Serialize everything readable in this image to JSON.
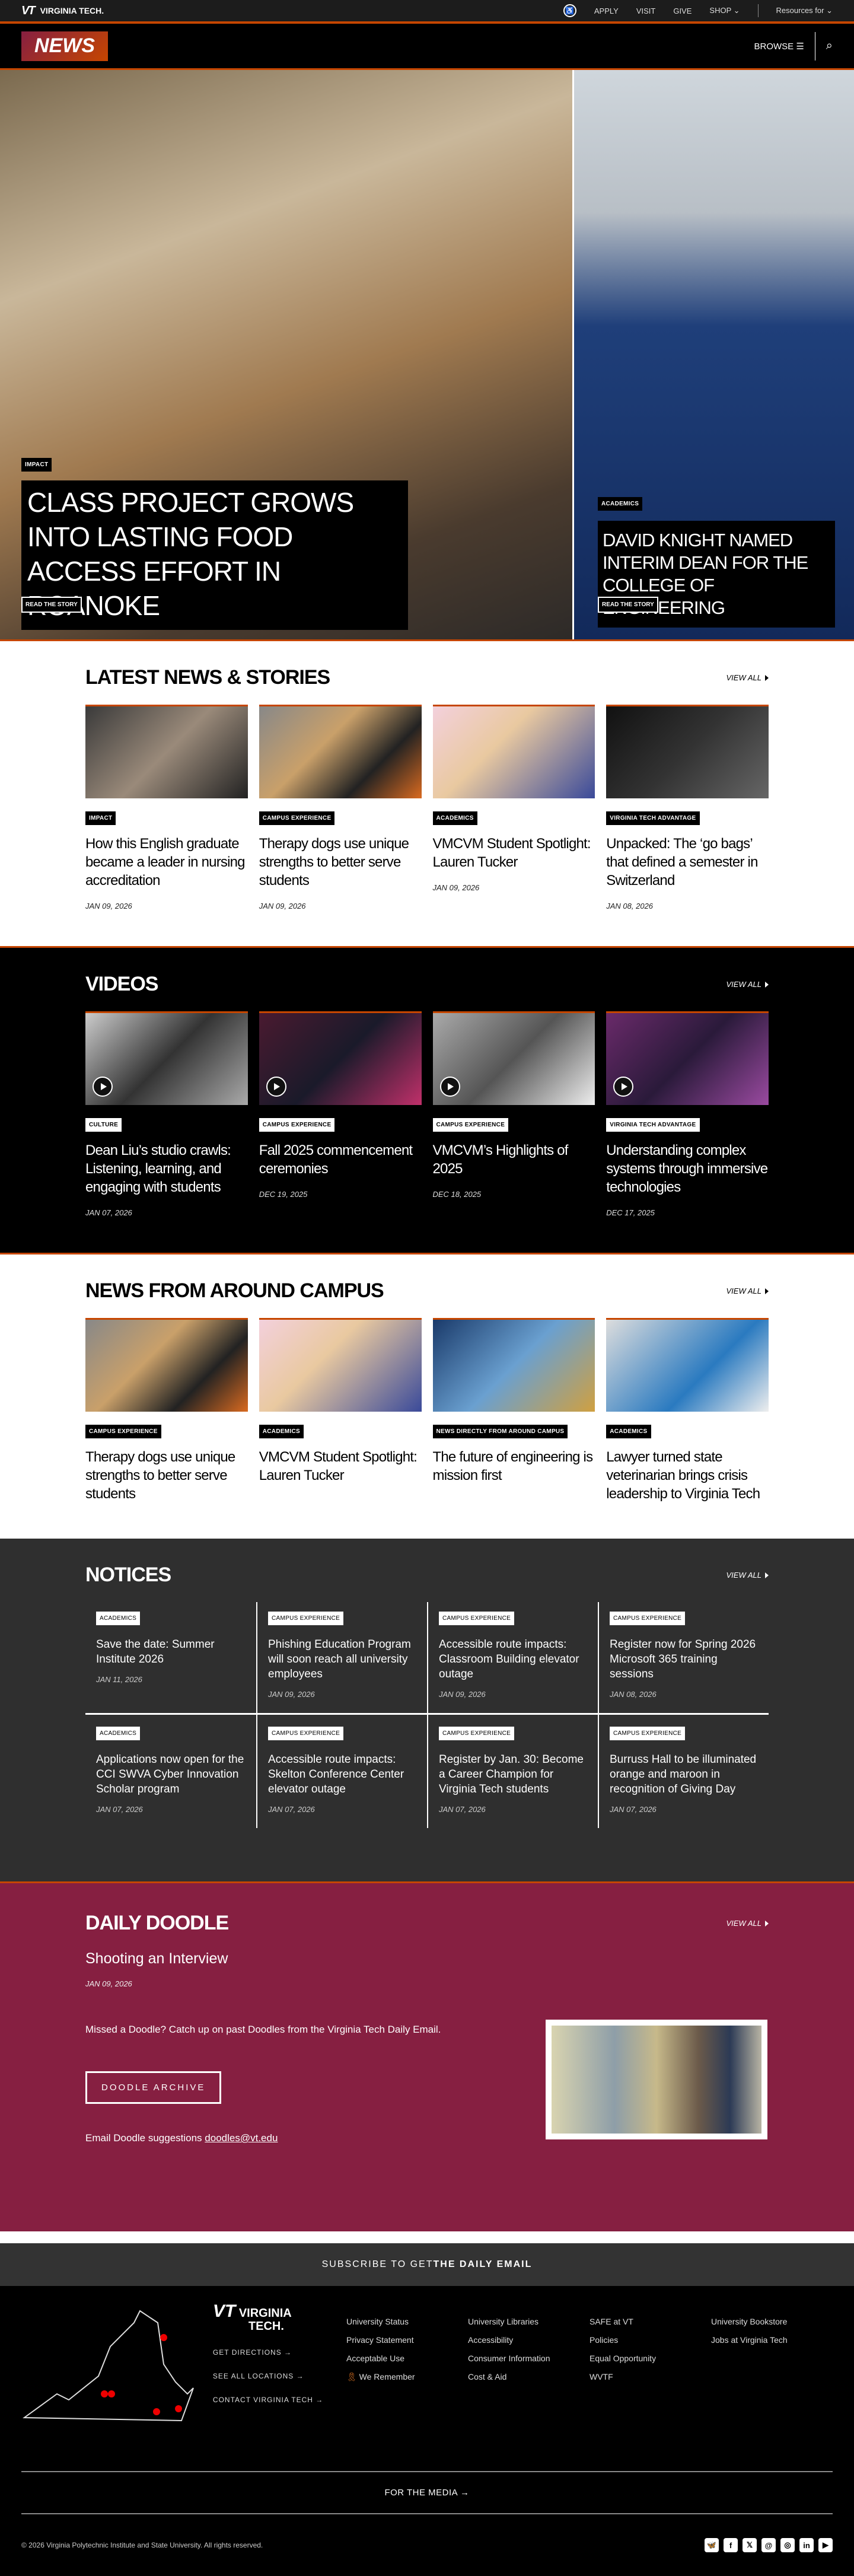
{
  "topbar": {
    "brand": "VIRGINIA TECH.",
    "links": [
      "APPLY",
      "VISIT",
      "GIVE",
      "SHOP",
      "Resources for"
    ]
  },
  "nav": {
    "logo": "NEWS",
    "browse": "BROWSE"
  },
  "hero": {
    "main": {
      "tag": "IMPACT",
      "title": "CLASS PROJECT GROWS INTO LASTING FOOD ACCESS EFFORT IN ROANOKE",
      "button": "READ THE STORY"
    },
    "side": {
      "tag": "ACADEMICS",
      "title": "DAVID KNIGHT NAMED INTERIM DEAN FOR THE COLLEGE OF ENGINEERING",
      "button": "READ THE STORY"
    }
  },
  "latest": {
    "title": "LATEST NEWS & STORIES",
    "view_all": "VIEW ALL",
    "items": [
      {
        "tag": "IMPACT",
        "title": "How this English graduate became a leader in nursing accreditation",
        "date": "JAN 09, 2026"
      },
      {
        "tag": "CAMPUS EXPERIENCE",
        "title": "Therapy dogs use unique strengths to better serve students",
        "date": "JAN 09, 2026"
      },
      {
        "tag": "ACADEMICS",
        "title": "VMCVM Student Spotlight: Lauren Tucker",
        "date": "JAN 09, 2026"
      },
      {
        "tag": "VIRGINIA TECH ADVANTAGE",
        "title": "Unpacked: The ‘go bags’ that defined a semester in Switzerland",
        "date": "JAN 08, 2026"
      }
    ]
  },
  "videos": {
    "title": "VIDEOS",
    "view_all": "VIEW ALL",
    "items": [
      {
        "tag": "CULTURE",
        "title": "Dean Liu’s studio crawls: Listening, learning, and engaging with students",
        "date": "JAN 07, 2026"
      },
      {
        "tag": "CAMPUS EXPERIENCE",
        "title": "Fall 2025 commencement ceremonies",
        "date": "DEC 19, 2025"
      },
      {
        "tag": "CAMPUS EXPERIENCE",
        "title": "VMCVM’s Highlights of 2025",
        "date": "DEC 18, 2025"
      },
      {
        "tag": "VIRGINIA TECH ADVANTAGE",
        "title": "Understanding complex systems through immersive technologies",
        "date": "DEC 17, 2025"
      }
    ]
  },
  "campus": {
    "title": "NEWS FROM AROUND CAMPUS",
    "view_all": "VIEW ALL",
    "items": [
      {
        "tag": "CAMPUS EXPERIENCE",
        "title": "Therapy dogs use unique strengths to better serve students"
      },
      {
        "tag": "ACADEMICS",
        "title": "VMCVM Student Spotlight: Lauren Tucker"
      },
      {
        "tag": "NEWS DIRECTLY FROM AROUND CAMPUS",
        "title": "The future of engineering is mission first"
      },
      {
        "tag": "ACADEMICS",
        "title": "Lawyer turned state veterinarian brings crisis leadership to Virginia Tech"
      }
    ]
  },
  "notices": {
    "title": "NOTICES",
    "view_all": "VIEW ALL",
    "items": [
      {
        "tag": "ACADEMICS",
        "title": "Save the date: Summer Institute 2026",
        "date": "JAN 11, 2026"
      },
      {
        "tag": "CAMPUS EXPERIENCE",
        "title": "Phishing Education Program will soon reach all university employees",
        "date": "JAN 09, 2026"
      },
      {
        "tag": "CAMPUS EXPERIENCE",
        "title": "Accessible route impacts: Classroom Building elevator outage",
        "date": "JAN 09, 2026"
      },
      {
        "tag": "CAMPUS EXPERIENCE",
        "title": "Register now for Spring 2026 Microsoft 365 training sessions",
        "date": "JAN 08, 2026"
      },
      {
        "tag": "ACADEMICS",
        "title": "Applications now open for the CCI SWVA Cyber Innovation Scholar program",
        "date": "JAN 07, 2026"
      },
      {
        "tag": "CAMPUS EXPERIENCE",
        "title": "Accessible route impacts: Skelton Conference Center elevator outage",
        "date": "JAN 07, 2026"
      },
      {
        "tag": "CAMPUS EXPERIENCE",
        "title": "Register by Jan. 30: Become a Career Champion for Virginia Tech students",
        "date": "JAN 07, 2026"
      },
      {
        "tag": "CAMPUS EXPERIENCE",
        "title": "Burruss Hall to be illuminated orange and maroon in recognition of Giving Day",
        "date": "JAN 07, 2026"
      }
    ]
  },
  "doodle": {
    "title": "DAILY DOODLE",
    "view_all": "VIEW ALL",
    "headline": "Shooting an Interview",
    "date": "JAN 09, 2026",
    "text": "Missed a Doodle? Catch up on past Doodles from the Virginia Tech Daily Email.",
    "button": "DOODLE ARCHIVE",
    "email_label": "Email Doodle suggestions",
    "email": "doodles@vt.edu"
  },
  "subscribe": {
    "prefix": "SUBSCRIBE TO GET",
    "bold": "THE DAILY EMAIL"
  },
  "footer": {
    "brand1": "VIRGINIA",
    "brand2": "TECH.",
    "links": [
      "GET DIRECTIONS →",
      "SEE ALL LOCATIONS →",
      "CONTACT VIRGINIA TECH →"
    ],
    "cols": [
      [
        "University Status",
        "Privacy Statement",
        "Acceptable Use",
        "We Remember"
      ],
      [
        "University Libraries",
        "Accessibility",
        "Consumer Information",
        "Cost & Aid"
      ],
      [
        "SAFE at VT",
        "Policies",
        "Equal Opportunity",
        "WVTF"
      ],
      [
        "University Bookstore",
        "Jobs at Virginia Tech"
      ]
    ],
    "media": "FOR THE MEDIA →",
    "copyright": "© 2026 Virginia Polytechnic Institute and State University. All rights reserved.",
    "social": [
      "bluesky",
      "facebook",
      "x",
      "threads",
      "instagram",
      "linkedin",
      "youtube"
    ]
  },
  "colors": {
    "orange": "#c64600",
    "maroon": "#861f41",
    "notices_bg": "#2f2f2f"
  }
}
